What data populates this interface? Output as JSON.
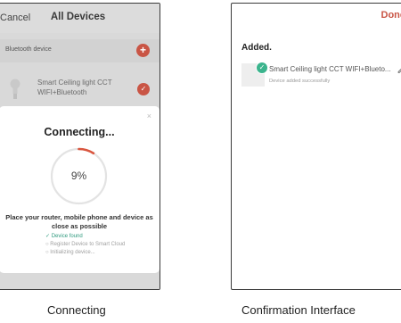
{
  "left_screen": {
    "nav": {
      "cancel_label": "Cancel",
      "title": "All Devices"
    },
    "section_label": "Bluetooth device",
    "device_name": "Smart Ceiling light CCT WIFI+Bluetooth",
    "modal": {
      "close_glyph": "×",
      "title": "Connecting...",
      "progress_label": "9%",
      "progress_value": 0.09,
      "message": "Place your router, mobile phone and device as close as possible",
      "steps": [
        {
          "label": "Device found",
          "state": "done"
        },
        {
          "label": "Register Device to Smart Cloud",
          "state": "pending"
        },
        {
          "label": "Initializing device...",
          "state": "pending"
        }
      ]
    }
  },
  "right_screen": {
    "done_label": "Done",
    "heading": "Added.",
    "device_name": "Smart Ceiling light CCT WIFI+Blueto...",
    "status": "Device added successfully"
  },
  "captions": {
    "left": "Connecting",
    "right": "Confirmation Interface"
  },
  "colors": {
    "accent_red": "#c95545",
    "success_green": "#3bb48d",
    "overlay_gray": "#d9d9d9"
  }
}
